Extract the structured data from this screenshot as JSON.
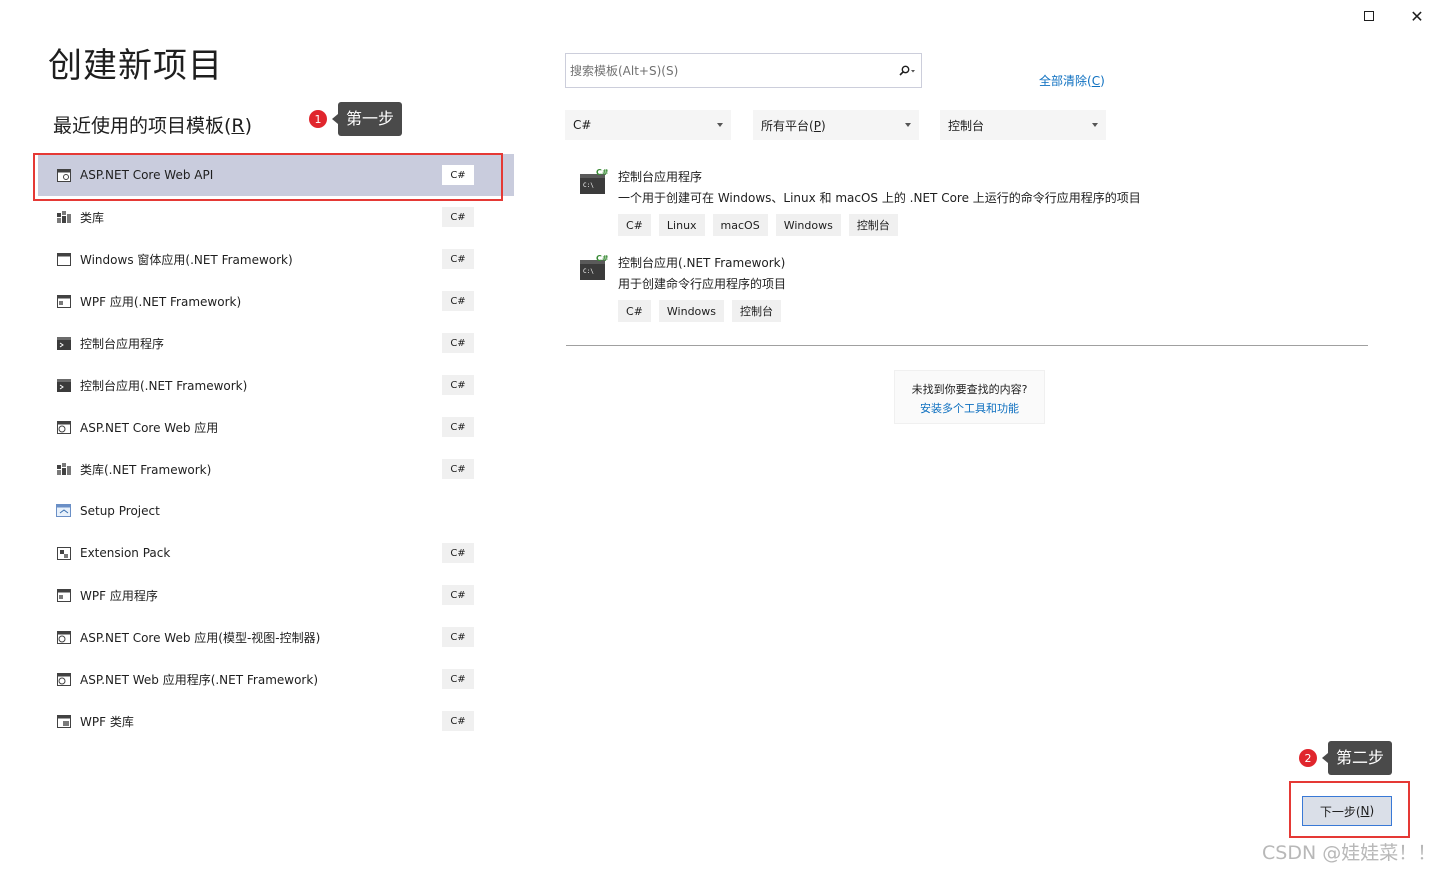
{
  "window": {
    "maximize_glyph": "maximize-icon",
    "close_glyph": "✕"
  },
  "page": {
    "title": "创建新项目"
  },
  "recent": {
    "title_prefix": "最近使用的项目模板(",
    "title_key": "R",
    "title_suffix": ")"
  },
  "callouts": [
    {
      "num": "1",
      "text": "第一步"
    },
    {
      "num": "2",
      "text": "第二步"
    }
  ],
  "templates": [
    {
      "name": "ASP.NET Core Web API",
      "lang": "C#",
      "icon": "web-api-icon",
      "selected": true
    },
    {
      "name": "类库",
      "lang": "C#",
      "icon": "class-library-icon"
    },
    {
      "name": "Windows 窗体应用(.NET Framework)",
      "lang": "C#",
      "icon": "windows-form-icon"
    },
    {
      "name": "WPF 应用(.NET Framework)",
      "lang": "C#",
      "icon": "wpf-app-icon"
    },
    {
      "name": "控制台应用程序",
      "lang": "C#",
      "icon": "console-app-icon"
    },
    {
      "name": "控制台应用(.NET Framework)",
      "lang": "C#",
      "icon": "console-app-icon"
    },
    {
      "name": "ASP.NET Core Web 应用",
      "lang": "C#",
      "icon": "web-app-icon"
    },
    {
      "name": "类库(.NET Framework)",
      "lang": "C#",
      "icon": "class-library-icon"
    },
    {
      "name": "Setup Project",
      "lang": "",
      "icon": "setup-project-icon"
    },
    {
      "name": "Extension Pack",
      "lang": "C#",
      "icon": "extension-pack-icon"
    },
    {
      "name": "WPF 应用程序",
      "lang": "C#",
      "icon": "wpf-app-icon"
    },
    {
      "name": "ASP.NET Core Web 应用(模型-视图-控制器)",
      "lang": "C#",
      "icon": "web-app-icon"
    },
    {
      "name": "ASP.NET Web 应用程序(.NET Framework)",
      "lang": "C#",
      "icon": "web-app-icon"
    },
    {
      "name": "WPF 类库",
      "lang": "C#",
      "icon": "wpf-library-icon"
    }
  ],
  "search": {
    "placeholder": "搜索模板(Alt+S)(S)",
    "value": ""
  },
  "clear_all": {
    "prefix": "全部清除(",
    "key": "C",
    "suffix": ")"
  },
  "filters": {
    "language": {
      "value": "C#"
    },
    "platform": {
      "prefix": "所有平台(",
      "key": "P",
      "suffix": ")"
    },
    "project_type": {
      "value": "控制台"
    }
  },
  "results": [
    {
      "title": "控制台应用程序",
      "description": "一个用于创建可在 Windows、Linux 和 macOS 上的 .NET Core 上运行的命令行应用程序的项目",
      "tags": [
        "C#",
        "Linux",
        "macOS",
        "Windows",
        "控制台"
      ]
    },
    {
      "title": "控制台应用(.NET Framework)",
      "description": "用于创建命令行应用程序的项目",
      "tags": [
        "C#",
        "Windows",
        "控制台"
      ]
    }
  ],
  "not_found": {
    "question": "未找到你要查找的内容?",
    "link": "安装多个工具和功能"
  },
  "next_button": {
    "prefix": "下一步(",
    "key": "N",
    "suffix": ")"
  },
  "watermark": "CSDN @娃娃菜！！",
  "colors": {
    "selected_bg": "#c9ccdd",
    "link": "#0e70c0",
    "highlight_red": "#e53935",
    "callout_red": "#e0262d",
    "callout_bg": "#4a4a4a"
  }
}
